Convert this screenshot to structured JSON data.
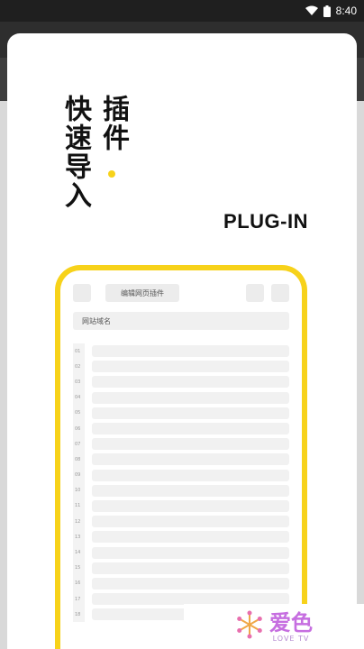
{
  "status_bar": {
    "time": "8:40",
    "wifi_icon": "wifi-icon",
    "battery_icon": "battery-icon"
  },
  "hero": {
    "vertical_left": "快速导入",
    "vertical_right": "插件",
    "tag": "PLUG-IN",
    "accent_color": "#f7d21a"
  },
  "mockup": {
    "title": "编辑网页插件",
    "domain_label": "网站域名",
    "line_numbers": [
      "01",
      "02",
      "03",
      "04",
      "05",
      "06",
      "07",
      "08",
      "09",
      "10",
      "11",
      "12",
      "13",
      "14",
      "15",
      "16",
      "17",
      "18"
    ]
  },
  "watermark": {
    "main": "爱色",
    "sub": "LOVE TV"
  }
}
